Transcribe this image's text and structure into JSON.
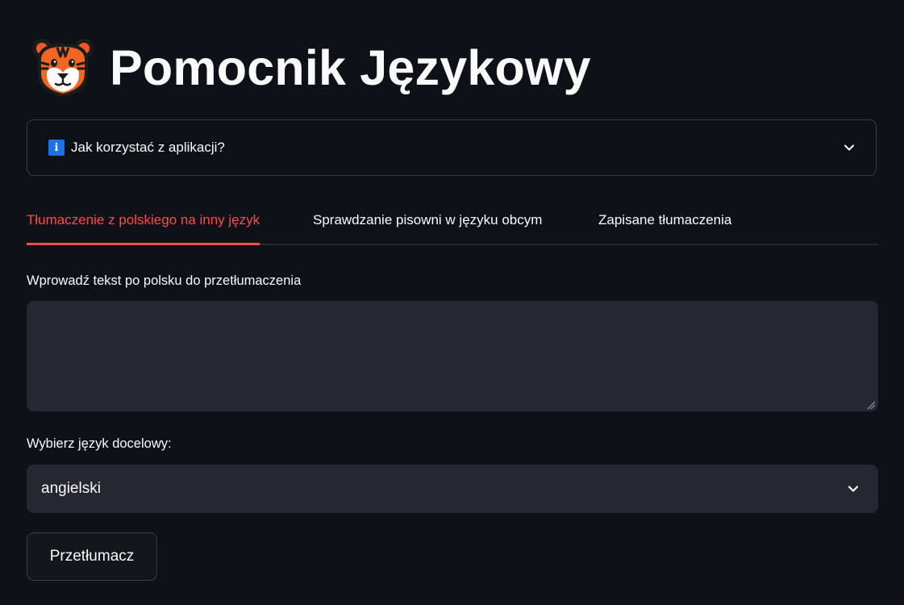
{
  "app": {
    "title": "Pomocnik Językowy",
    "logo_icon": "tiger-face-icon"
  },
  "expander": {
    "icon": "info-icon",
    "icon_glyph": "i",
    "label": "Jak korzystać z aplikacji?",
    "expanded": false
  },
  "tabs": [
    {
      "label": "Tłumaczenie z polskiego na inny język",
      "active": true
    },
    {
      "label": "Sprawdzanie pisowni w języku obcym",
      "active": false
    },
    {
      "label": "Zapisane tłumaczenia",
      "active": false
    }
  ],
  "translate_form": {
    "input_label": "Wprowadź tekst po polsku do przetłumaczenia",
    "input_value": "",
    "select_label": "Wybierz język docelowy:",
    "select_value": "angielski",
    "button_label": "Przetłumacz"
  },
  "colors": {
    "background": "#0e1117",
    "accent": "#ff4b4b",
    "input_background": "#262730",
    "border": "#3b3d45",
    "text": "#fafafa",
    "info_blue": "#1a73e8"
  }
}
